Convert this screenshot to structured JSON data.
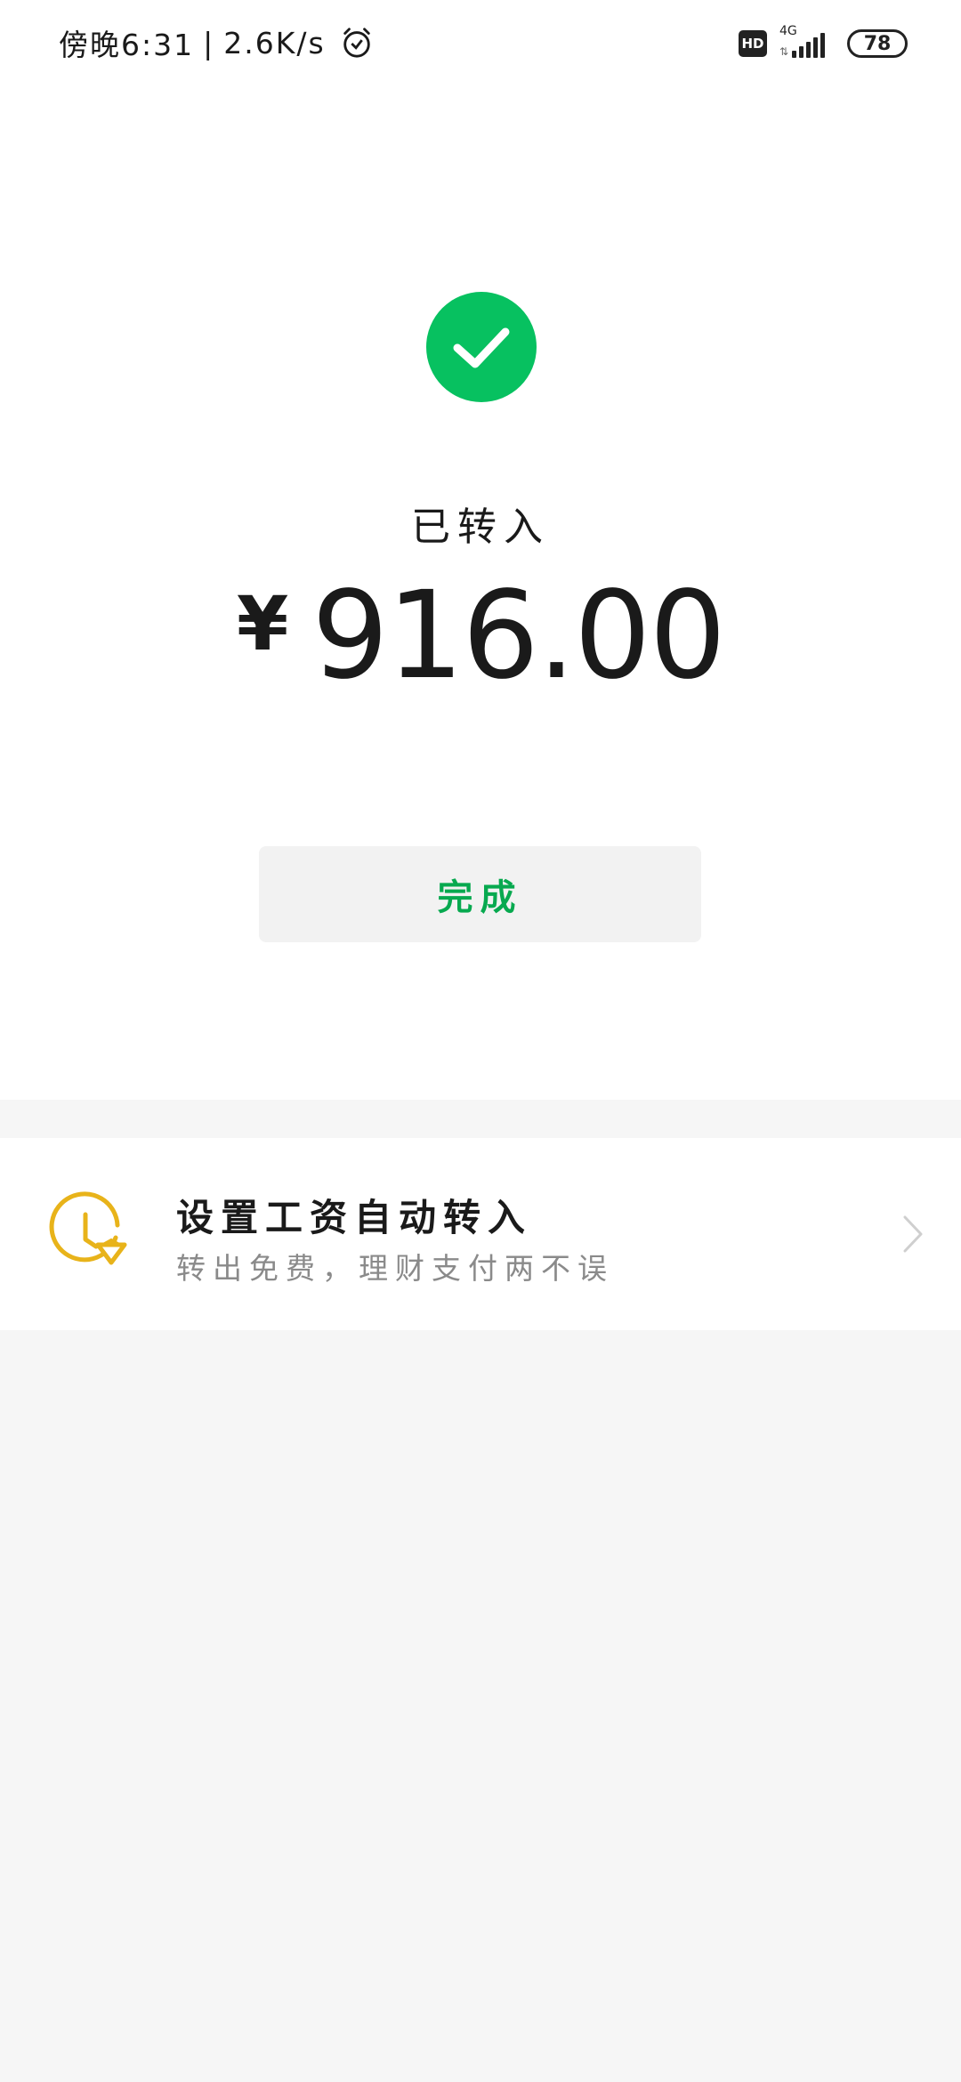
{
  "status_bar": {
    "time": "傍晚6:31",
    "separator": "|",
    "net_speed": "2.6K/s",
    "hd_badge": "HD",
    "network_type": "4G",
    "battery": "78"
  },
  "result": {
    "status_text": "已转入",
    "currency_symbol": "¥",
    "amount": "916.00",
    "done_button_label": "完成"
  },
  "promo": {
    "title": "设置工资自动转入",
    "subtitle": "转出免费，理财支付两不误"
  },
  "colors": {
    "accent_green": "#07c160",
    "button_text_green": "#07a94f",
    "promo_icon_yellow": "#e8b31a"
  },
  "icons": [
    "alarm-icon",
    "check-icon",
    "clock-icon",
    "chevron-right-icon"
  ]
}
